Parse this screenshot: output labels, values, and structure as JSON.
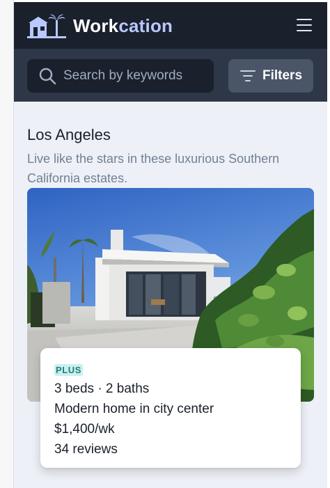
{
  "app": {
    "brand_prefix": "Work",
    "brand_suffix": "cation"
  },
  "search": {
    "placeholder": "Search by keywords",
    "value": ""
  },
  "filters": {
    "label": "Filters"
  },
  "location": {
    "city": "Los Angeles",
    "description": "Live like the stars in these luxurious Southern California estates."
  },
  "listing": {
    "badge": "PLUS",
    "rooms": "3 beds · 2 baths",
    "title": "Modern home in city center",
    "price": "$1,400/wk",
    "reviews": "34 reviews"
  },
  "icons": {
    "logo": "house-palm-logo-icon",
    "menu": "hamburger-menu-icon",
    "search": "search-icon",
    "filters": "filter-lines-icon"
  },
  "colors": {
    "header_bg": "#1a202c",
    "searchbar_bg": "#2d3748",
    "accent": "#b9c8ff",
    "badge_bg": "#c6f1f0",
    "badge_text": "#2c7a7b",
    "page_bg": "#edf0f6"
  }
}
